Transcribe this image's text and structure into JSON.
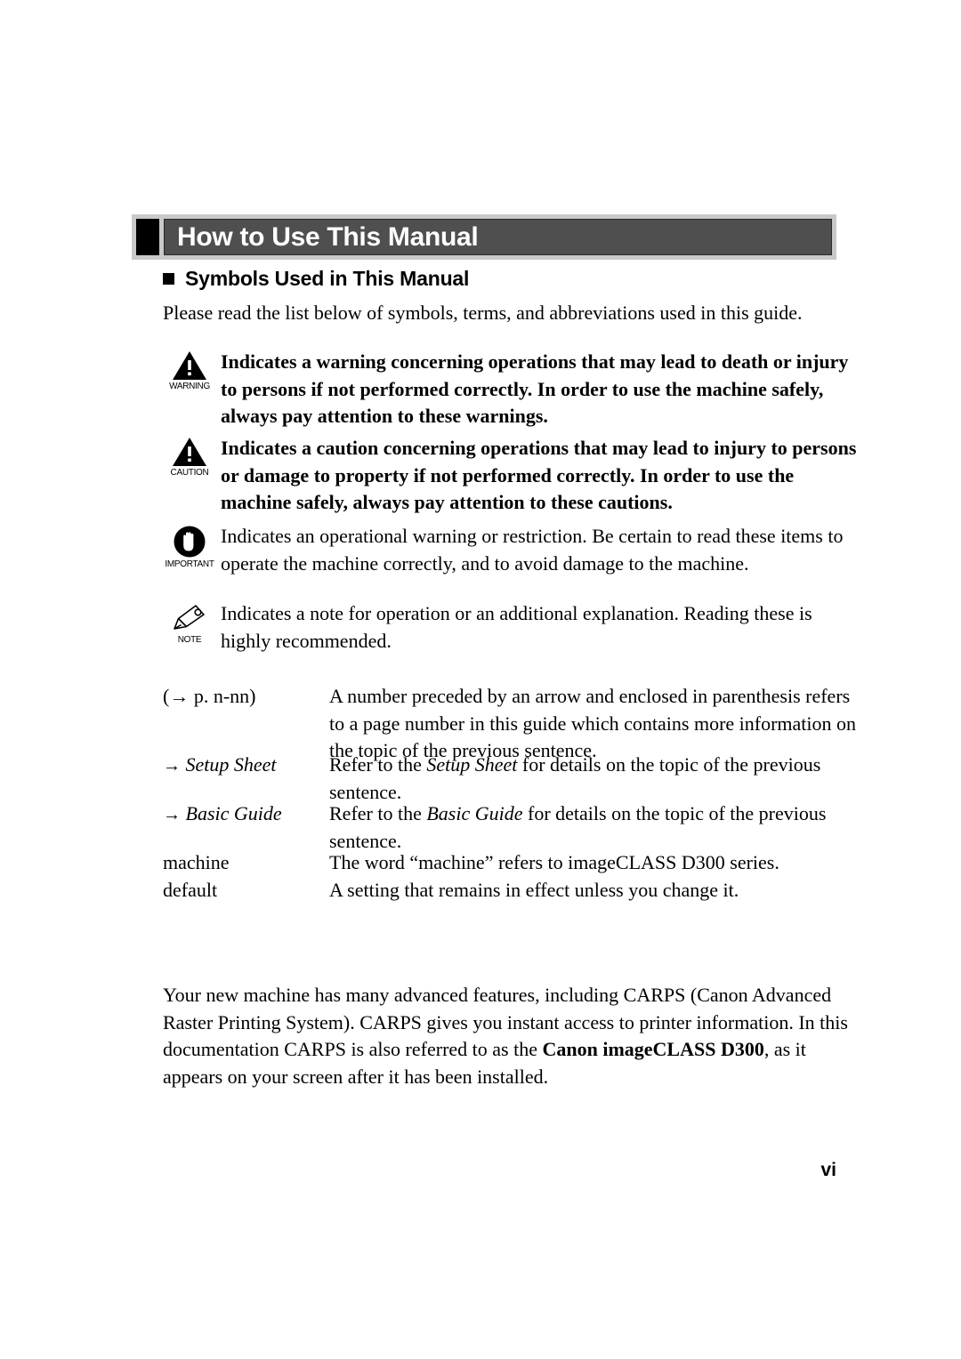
{
  "header": {
    "title": "How to Use This Manual"
  },
  "subheading": {
    "label": "Symbols Used in This Manual",
    "bullet_icon": "square-bullet-icon"
  },
  "intro": {
    "text": "Please read the list below of symbols, terms, and abbreviations used in this guide."
  },
  "symbols": [
    {
      "icon": "warning-triangle-icon",
      "caption": "WARNING",
      "bold": true,
      "text": "Indicates a warning concerning operations that may lead to death or injury to persons if not performed correctly. In order to use the machine safely, always pay attention to these warnings."
    },
    {
      "icon": "caution-triangle-icon",
      "caption": "CAUTION",
      "bold": true,
      "text": "Indicates a caution concerning operations that may lead to injury to persons or damage to property if not performed correctly. In order to use the machine safely, always pay attention to these cautions."
    },
    {
      "icon": "important-hand-icon",
      "caption": "IMPORTANT",
      "bold": false,
      "text": "Indicates an operational warning or restriction. Be certain to read these items to operate the machine correctly, and to avoid damage to the machine."
    },
    {
      "icon": "note-pencil-icon",
      "caption": "NOTE",
      "bold": false,
      "text": "Indicates a note for operation or an additional explanation. Reading these is highly recommended."
    }
  ],
  "references": [
    {
      "term_plain": "(→  p. n-nn)",
      "desc": "A number preceded by an arrow and enclosed in parenthesis refers to a page number in this guide which contains more information on the topic of the previous sentence."
    },
    {
      "term_arrow": "→",
      "term_italic": "Setup Sheet",
      "desc_pre": "Refer to the ",
      "desc_italic": "Setup Sheet",
      "desc_post": " for details on the topic of the previous sentence."
    },
    {
      "term_arrow": "→",
      "term_italic": "Basic Guide",
      "desc_pre": "Refer to the ",
      "desc_italic": "Basic Guide",
      "desc_post": " for details on the topic of the previous sentence."
    },
    {
      "term_plain": "machine",
      "desc": "The word “machine” refers to imageCLASS D300 series."
    },
    {
      "term_plain": "default",
      "desc": "A setting that remains in effect unless you change it."
    }
  ],
  "bottom_paragraph": {
    "pre": "Your new machine has many advanced features, including CARPS (Canon Advanced Raster Printing System). CARPS gives you instant access to printer information. In this documentation CARPS is also referred to as the ",
    "bold": "Canon imageCLASS D300",
    "post": ", as it appears on your screen after it has been installed."
  },
  "page_number": "vi",
  "colors": {
    "header_bar_outer": "#c9c9c9",
    "header_bar_inner": "#4f4f4f",
    "header_square": "#000000",
    "text": "#000000",
    "background": "#ffffff"
  }
}
